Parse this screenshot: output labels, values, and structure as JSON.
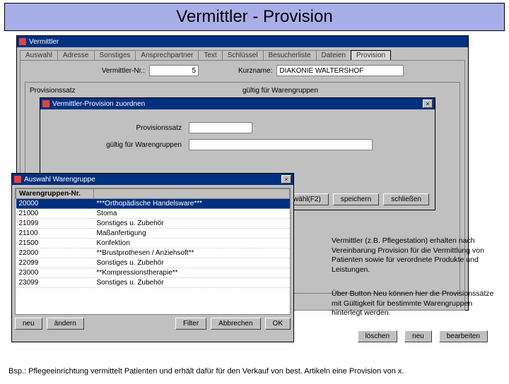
{
  "title_banner": "Vermittler - Provision",
  "win1": {
    "title": "Vermittler",
    "tabs": [
      "Auswahl",
      "Adresse",
      "Sonstiges",
      "Ansprechpartner",
      "Text",
      "Schlüssel",
      "Besucherliste",
      "Dateien",
      "Provision"
    ],
    "active_tab": 8,
    "lbl_nr": "Vermittler-Nr.:",
    "val_nr": "5",
    "lbl_kurz": "Kurzname:",
    "val_kurz": "DIAKONIE WALTERSHOF",
    "sub_left_lbl": "Provisionssatz",
    "sub_right_lbl": "gültig für Warengruppen",
    "btn_loeschen": "löschen",
    "btn_neu": "neu",
    "btn_bearbeiten": "bearbeiten"
  },
  "win2": {
    "title": "Vermittler-Provision zuordnen",
    "lbl_prov": "Provisionssatz",
    "lbl_wg": "gültig für Warengruppen",
    "btn_auswahl": "auswähl(F2)",
    "btn_speichern": "speichern",
    "btn_schliessen": "schließen"
  },
  "win3": {
    "title": "Auswahl Warengruppe",
    "header": "Warengruppen-Nr.",
    "rows": [
      {
        "nr": "20000",
        "txt": "***Orthopädische Handelsware***"
      },
      {
        "nr": "21000",
        "txt": "Stoma"
      },
      {
        "nr": "21099",
        "txt": "Sonstiges u. Zubehör"
      },
      {
        "nr": "21100",
        "txt": "Maßanfertigung"
      },
      {
        "nr": "21500",
        "txt": "Konfektion"
      },
      {
        "nr": "22000",
        "txt": "**Brustprothesen / Anziehsoft**"
      },
      {
        "nr": "22099",
        "txt": "Sonstiges u. Zubehör"
      },
      {
        "nr": "23000",
        "txt": "**Kompressionstherapie**"
      },
      {
        "nr": "23099",
        "txt": "Sonstiges u. Zubehör"
      }
    ],
    "selected": 0,
    "btn_neu": "neu",
    "btn_aendern": "ändern",
    "btn_filter": "Filter",
    "btn_abbrechen": "Abbrechen",
    "btn_ok": "OK"
  },
  "notes": {
    "n1": "Vermittler (z.B. Pflegestation) erhalten nach Vereinbarung Provision für die Vermittlung von Patienten sowie für verordnete Produkte und Leistungen.",
    "n2": "Über Button Neu können hier die Provisionssätze mit Gültigkeit für bestimmte Warengruppen hinterlegt werden."
  },
  "footer": "Bsp.: Pflegeeinrichtung vermittelt Patienten und erhält dafür für den Verkauf von best. Artikeln eine Provision von x."
}
